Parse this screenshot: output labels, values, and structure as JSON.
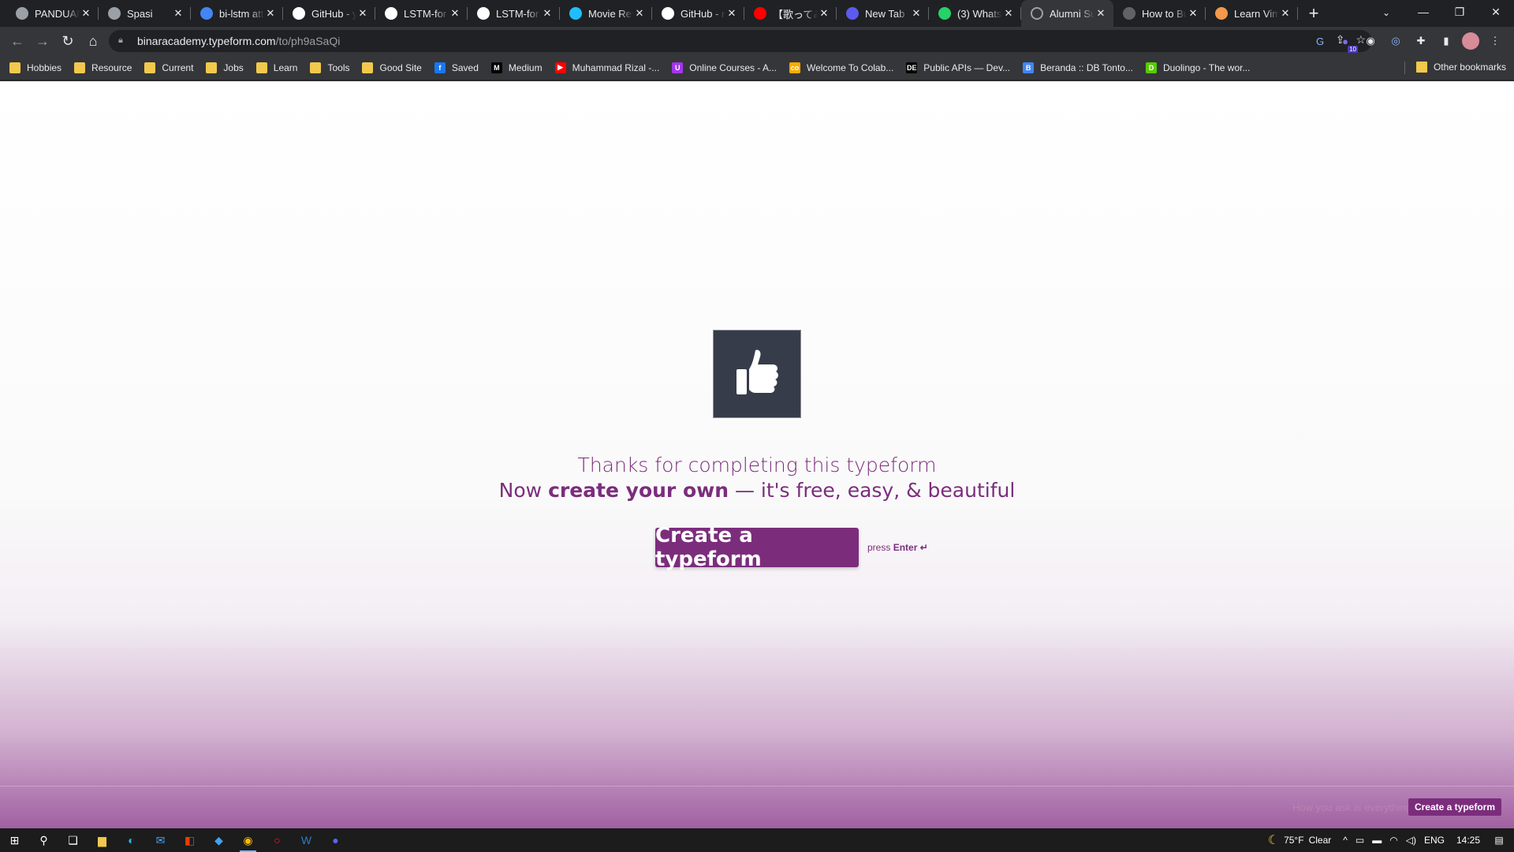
{
  "tabs": [
    {
      "title": "PANDUAN",
      "favicon_color": "#9aa0a6",
      "icon": "globe-icon"
    },
    {
      "title": "Spasi",
      "favicon_color": "#9aa0a6",
      "icon": "globe-icon"
    },
    {
      "title": "bi-lstm att",
      "favicon_color": "#4285f4",
      "icon": "google-icon"
    },
    {
      "title": "GitHub - y",
      "favicon_color": "#ffffff",
      "icon": "github-icon"
    },
    {
      "title": "LSTM-for",
      "favicon_color": "#ffffff",
      "icon": "github-icon"
    },
    {
      "title": "LSTM-for",
      "favicon_color": "#ffffff",
      "icon": "github-icon"
    },
    {
      "title": "Movie Rev",
      "favicon_color": "#20beff",
      "icon": "kaggle-icon"
    },
    {
      "title": "GitHub - r",
      "favicon_color": "#ffffff",
      "icon": "github-icon"
    },
    {
      "title": "【歌ってみ】",
      "favicon_color": "#ff0000",
      "icon": "youtube-icon"
    },
    {
      "title": "New Tab",
      "favicon_color": "#5b5bf0",
      "icon": "newtab-icon"
    },
    {
      "title": "(3) Whats",
      "favicon_color": "#25d366",
      "icon": "whatsapp-icon"
    },
    {
      "title": "Alumni Su",
      "favicon_color": "#202124",
      "icon": "loading-icon",
      "active": true
    },
    {
      "title": "How to Bu",
      "favicon_color": "#5f6368",
      "icon": "openai-icon"
    },
    {
      "title": "Learn Vim",
      "favicon_color": "#f2994a",
      "icon": "vim-icon"
    }
  ],
  "browser": {
    "url_host": "binaracademy.typeform.com",
    "url_path": "/to/ph9aSaQi",
    "extension_badge": "10"
  },
  "bookmarks": [
    {
      "label": "Hobbies",
      "type": "folder"
    },
    {
      "label": "Resource",
      "type": "folder"
    },
    {
      "label": "Current",
      "type": "folder"
    },
    {
      "label": "Jobs",
      "type": "folder"
    },
    {
      "label": "Learn",
      "type": "folder"
    },
    {
      "label": "Tools",
      "type": "folder"
    },
    {
      "label": "Good Site",
      "type": "folder"
    },
    {
      "label": "Saved",
      "type": "link",
      "icon_color": "#1877f2",
      "glyph": "f"
    },
    {
      "label": "Medium",
      "type": "link",
      "icon_color": "#000000",
      "glyph": "M"
    },
    {
      "label": "Muhammad Rizal -...",
      "type": "link",
      "icon_color": "#ff0000",
      "glyph": "▶"
    },
    {
      "label": "Online Courses - A...",
      "type": "link",
      "icon_color": "#a435f0",
      "glyph": "U"
    },
    {
      "label": "Welcome To Colab...",
      "type": "link",
      "icon_color": "#f9ab00",
      "glyph": "co"
    },
    {
      "label": "Public APIs — Dev...",
      "type": "link",
      "icon_color": "#000000",
      "glyph": "DE"
    },
    {
      "label": "Beranda :: DB Tonto...",
      "type": "link",
      "icon_color": "#4285f4",
      "glyph": "B"
    },
    {
      "label": "Duolingo - The wor...",
      "type": "link",
      "icon_color": "#58cc02",
      "glyph": "D"
    }
  ],
  "other_bookmarks": "Other bookmarks",
  "page": {
    "line1": "Thanks for completing this typeform",
    "line2_prefix": "Now ",
    "line2_bold": "create your own",
    "line2_suffix": " — it's free, easy, & beautiful",
    "button_label": "Create a typeform",
    "press_prefix": "press ",
    "press_key": "Enter ↵",
    "tagline": "How you ask is everything",
    "footer_button": "Create a typeform",
    "accent_color": "#7b2d7c"
  },
  "taskbar": {
    "temperature": "75°F",
    "weather": "Clear",
    "language": "ENG",
    "time": "14:25"
  }
}
